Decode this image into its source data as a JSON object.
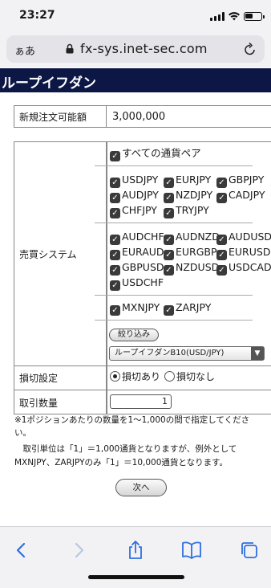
{
  "status_bar": {
    "time": "23:27"
  },
  "browser": {
    "aa_label": "ぁあ",
    "domain": "fx-sys.inet-sec.com"
  },
  "page_title": "ループイフダン",
  "new_order": {
    "label": "新規注文可能額",
    "value": "3,000,000"
  },
  "trade_system": {
    "label": "売買システム",
    "all_pairs": "すべての通貨ペア",
    "group_jpy": [
      "USDJPY",
      "EURJPY",
      "GBPJPY",
      "AUDJPY",
      "NZDJPY",
      "CADJPY",
      "CHFJPY",
      "TRYJPY"
    ],
    "group_cross": [
      "AUDCHF",
      "AUDNZD",
      "AUDUSD",
      "EURAUD",
      "EURGBP",
      "EURUSD",
      "GBPUSD",
      "NZDUSD",
      "USDCAD",
      "USDCHF"
    ],
    "group_emerging": [
      "MXNJPY",
      "ZARJPY"
    ],
    "filter_button": "絞り込み",
    "selected_option": "ループイフダンB10(USD/JPY)"
  },
  "stop_loss": {
    "label": "損切設定",
    "option_on": "損切あり",
    "option_off": "損切なし"
  },
  "quantity": {
    "label": "取引数量",
    "value": "1"
  },
  "notes": [
    "※1ポジションあたりの数量を1〜1,000の間で指定してくださ",
    "い。",
    "　取引単位は「1」＝1,000通貨となりますが、例外として",
    "MXNJPY、ZARJPYのみ「1」＝10,000通貨となります。"
  ],
  "next_button": "次へ",
  "colors": {
    "title_band": "#0c1745",
    "checkbox": "#3a3a3a"
  }
}
